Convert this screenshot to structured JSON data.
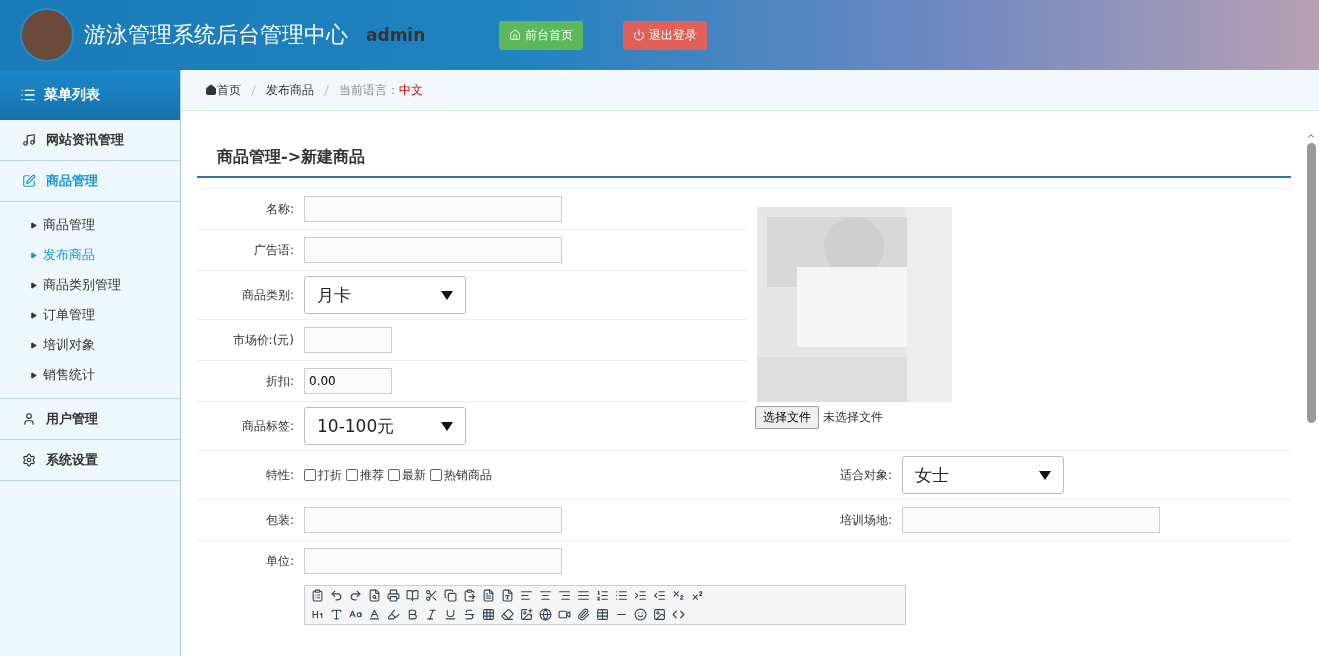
{
  "header": {
    "title": "游泳管理系统后台管理中心",
    "user": "admin",
    "buttons": [
      {
        "label": "前台首页",
        "kind": "home"
      },
      {
        "label": "退出登录",
        "kind": "logout"
      }
    ]
  },
  "sidebar": {
    "heading": "菜单列表",
    "groups": [
      {
        "label": "网站资讯管理",
        "kind": "music",
        "selected": false
      },
      {
        "label": "商品管理",
        "kind": "edit",
        "selected": true,
        "children": [
          {
            "label": "商品管理",
            "selected": false
          },
          {
            "label": "发布商品",
            "selected": true
          },
          {
            "label": "商品类别管理",
            "selected": false
          },
          {
            "label": "订单管理",
            "selected": false
          },
          {
            "label": "培训对象",
            "selected": false
          },
          {
            "label": "销售统计",
            "selected": false
          }
        ]
      },
      {
        "label": "用户管理",
        "kind": "user",
        "selected": false
      },
      {
        "label": "系统设置",
        "kind": "settings",
        "selected": false
      }
    ]
  },
  "breadcrumb": {
    "items": [
      "首页",
      "发布商品"
    ],
    "language_label": "当前语言：",
    "language": "中文"
  },
  "form": {
    "title": "商品管理->新建商品",
    "fields": [
      {
        "label": "名称:",
        "kind": "text"
      },
      {
        "label": "广告语:",
        "kind": "text"
      },
      {
        "label": "商品类别:",
        "kind": "select",
        "value": "月卡"
      },
      {
        "label": "市场价:(元)",
        "kind": "short"
      },
      {
        "label": "折扣:",
        "kind": "short",
        "value": "0.00"
      },
      {
        "label": "商品标签:",
        "kind": "select",
        "value": "10-100元"
      }
    ],
    "image": {
      "kind": "picture",
      "file_button": "选择文件",
      "file_status": "未选择文件"
    },
    "features": {
      "label": "特性:",
      "options": [
        {
          "label": "打折",
          "checked": false
        },
        {
          "label": "推荐",
          "checked": false
        },
        {
          "label": "最新",
          "checked": false
        },
        {
          "label": "热销商品",
          "checked": false
        }
      ]
    },
    "audience": {
      "label": "适合对象:",
      "value": "女士"
    },
    "packaging": {
      "label": "包装:"
    },
    "venue": {
      "label": "培训场地:"
    },
    "unit": {
      "label": "单位:"
    }
  }
}
